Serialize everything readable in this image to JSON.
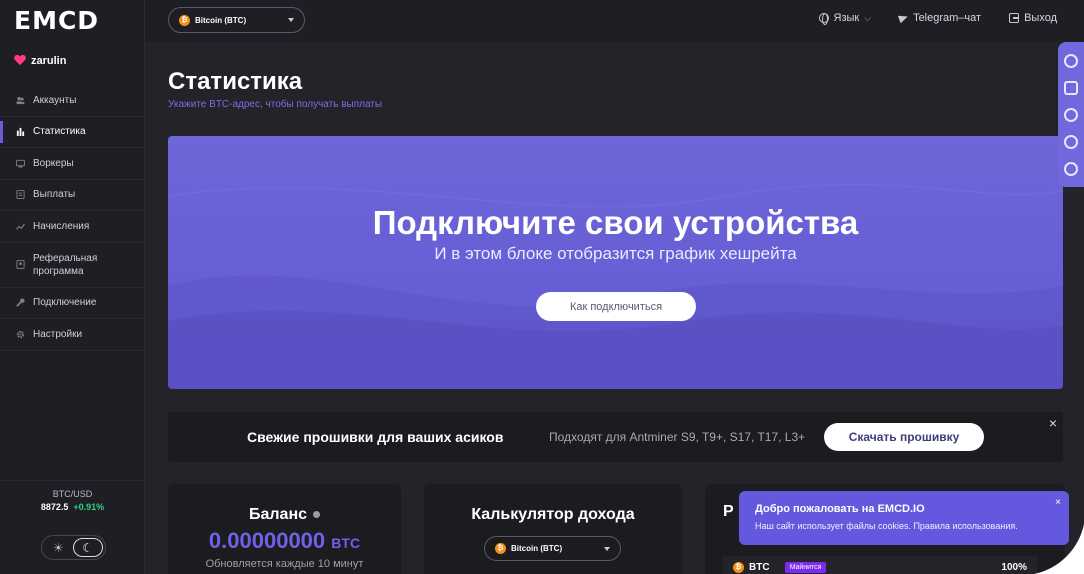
{
  "brand": {
    "logo_text": "EMCD"
  },
  "user": {
    "name": "zarulin"
  },
  "sidebar": {
    "items": [
      {
        "label": "Аккаунты",
        "icon": "users-icon"
      },
      {
        "label": "Статистика",
        "icon": "bar-chart-icon",
        "active": true
      },
      {
        "label": "Воркеры",
        "icon": "workers-icon"
      },
      {
        "label": "Выплаты",
        "icon": "payouts-icon"
      },
      {
        "label": "Начисления",
        "icon": "accruals-icon"
      },
      {
        "label": "Реферальная программа",
        "icon": "referral-icon"
      },
      {
        "label": "Подключение",
        "icon": "wrench-icon"
      },
      {
        "label": "Настройки",
        "icon": "gear-icon"
      }
    ],
    "rate": {
      "pair": "BTC/USD",
      "price": "8872.5",
      "change": "+0.91%"
    },
    "theme": {
      "light_icon": "sun-icon",
      "dark_icon": "moon-icon"
    }
  },
  "topbar": {
    "coin_select": "Bitcoin (BTC)",
    "language": "Язык",
    "telegram": "Telegram–чат",
    "logout": "Выход"
  },
  "page": {
    "title": "Статистика",
    "subtitle": "Укажите BTC-адрес, чтобы получать выплаты"
  },
  "hero": {
    "title": "Подключите свои устройства",
    "subtitle": "И в этом блоке отобразится график хешрейта",
    "button": "Как подключиться"
  },
  "firmware": {
    "title": "Свежие прошивки для ваших асиков",
    "description": "Подходят для Antminer S9, T9+, S17, T17, L3+",
    "button": "Скачать прошивку",
    "close": "×"
  },
  "balance": {
    "title": "Баланс",
    "value": "0.00000000",
    "unit": "BTC",
    "note": "Обновляется каждые 10 минут"
  },
  "calculator": {
    "title": "Калькулятор дохода",
    "coin_select": "Bitcoin (BTC)"
  },
  "third_card": {
    "title": "Р",
    "row": {
      "coin": "BTC",
      "badge": "Майнится",
      "percent": "100%"
    }
  },
  "cookie": {
    "title": "Добро пожаловать на EMCD.IO",
    "text": "Наш сайт использует файлы cookies. Правила использования.",
    "close": "×"
  },
  "colors": {
    "accent": "#6b5dd3",
    "positive": "#35d07f",
    "btc": "#f7931a",
    "badge": "#7a2cf0"
  }
}
